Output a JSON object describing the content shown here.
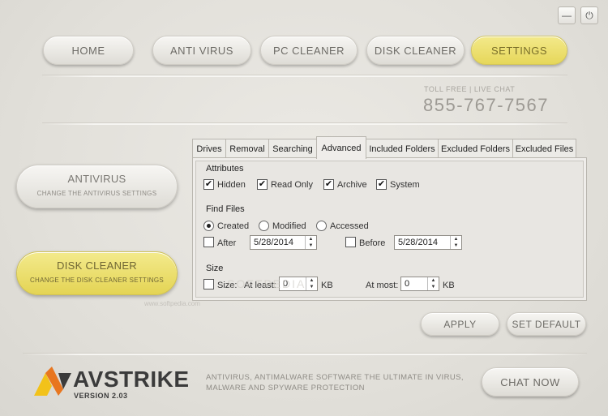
{
  "window": {
    "minimize_label": "—",
    "close_label": "⏻"
  },
  "nav": {
    "home": "HOME",
    "antivirus": "ANTI VIRUS",
    "pc_cleaner": "PC CLEANER",
    "disk_cleaner": "DISK CLEANER",
    "settings": "SETTINGS"
  },
  "contact": {
    "label": "TOLL FREE | LIVE CHAT",
    "phone": "855-767-7567"
  },
  "sidebar": {
    "antivirus": {
      "title": "ANTIVIRUS",
      "subtitle": "CHANGE THE ANTIVIRUS SETTINGS"
    },
    "disk_cleaner": {
      "title": "DISK CLEANER",
      "subtitle": "CHANGE THE DISK CLEANER SETTINGS"
    }
  },
  "tabs": [
    "Drives",
    "Removal",
    "Searching",
    "Advanced",
    "Included Folders",
    "Excluded Folders",
    "Excluded Files"
  ],
  "active_tab": "Advanced",
  "attributes": {
    "heading": "Attributes",
    "hidden": {
      "label": "Hidden",
      "checked": "✔"
    },
    "read_only": {
      "label": "Read Only",
      "checked": "✔"
    },
    "archive": {
      "label": "Archive",
      "checked": "✔"
    },
    "system": {
      "label": "System",
      "checked": "✔"
    }
  },
  "find_files": {
    "heading": "Find Files",
    "created": "Created",
    "modified": "Modified",
    "accessed": "Accessed",
    "selected": "Created",
    "after_label": "After",
    "after_date": "5/28/2014",
    "before_label": "Before",
    "before_date": "5/28/2014"
  },
  "size": {
    "heading": "Size",
    "size_label": "Size:",
    "at_least_label": "At least:",
    "at_least_value": "0",
    "at_least_unit": "KB",
    "at_most_label": "At most:",
    "at_most_value": "0",
    "at_most_unit": "KB"
  },
  "actions": {
    "apply": "APPLY",
    "set_default": "SET DEFAULT"
  },
  "watermark": "www.softpedia.com",
  "watermark_large": "SOFTPEDIA",
  "footer": {
    "logo_av": "AV",
    "logo_strike": "STRIKE",
    "version": "VERSION 2.03",
    "tagline": "ANTIVIRUS, ANTIMALWARE SOFTWARE THE ULTIMATE IN VIRUS, MALWARE AND SPYWARE PROTECTION",
    "chat_now": "CHAT NOW"
  },
  "colors": {
    "accent_yellow": "#e9dc64",
    "background": "#e4e2dd",
    "logo_orange": "#e8761f",
    "logo_yellow": "#f2c21a"
  }
}
